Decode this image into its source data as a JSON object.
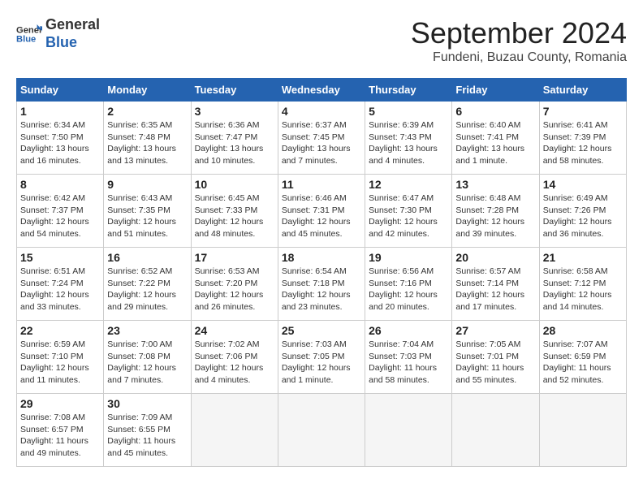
{
  "header": {
    "logo_line1": "General",
    "logo_line2": "Blue",
    "month_title": "September 2024",
    "location": "Fundeni, Buzau County, Romania"
  },
  "calendar": {
    "headers": [
      "Sunday",
      "Monday",
      "Tuesday",
      "Wednesday",
      "Thursday",
      "Friday",
      "Saturday"
    ],
    "weeks": [
      [
        {
          "day": "1",
          "info": "Sunrise: 6:34 AM\nSunset: 7:50 PM\nDaylight: 13 hours\nand 16 minutes."
        },
        {
          "day": "2",
          "info": "Sunrise: 6:35 AM\nSunset: 7:48 PM\nDaylight: 13 hours\nand 13 minutes."
        },
        {
          "day": "3",
          "info": "Sunrise: 6:36 AM\nSunset: 7:47 PM\nDaylight: 13 hours\nand 10 minutes."
        },
        {
          "day": "4",
          "info": "Sunrise: 6:37 AM\nSunset: 7:45 PM\nDaylight: 13 hours\nand 7 minutes."
        },
        {
          "day": "5",
          "info": "Sunrise: 6:39 AM\nSunset: 7:43 PM\nDaylight: 13 hours\nand 4 minutes."
        },
        {
          "day": "6",
          "info": "Sunrise: 6:40 AM\nSunset: 7:41 PM\nDaylight: 13 hours\nand 1 minute."
        },
        {
          "day": "7",
          "info": "Sunrise: 6:41 AM\nSunset: 7:39 PM\nDaylight: 12 hours\nand 58 minutes."
        }
      ],
      [
        {
          "day": "8",
          "info": "Sunrise: 6:42 AM\nSunset: 7:37 PM\nDaylight: 12 hours\nand 54 minutes."
        },
        {
          "day": "9",
          "info": "Sunrise: 6:43 AM\nSunset: 7:35 PM\nDaylight: 12 hours\nand 51 minutes."
        },
        {
          "day": "10",
          "info": "Sunrise: 6:45 AM\nSunset: 7:33 PM\nDaylight: 12 hours\nand 48 minutes."
        },
        {
          "day": "11",
          "info": "Sunrise: 6:46 AM\nSunset: 7:31 PM\nDaylight: 12 hours\nand 45 minutes."
        },
        {
          "day": "12",
          "info": "Sunrise: 6:47 AM\nSunset: 7:30 PM\nDaylight: 12 hours\nand 42 minutes."
        },
        {
          "day": "13",
          "info": "Sunrise: 6:48 AM\nSunset: 7:28 PM\nDaylight: 12 hours\nand 39 minutes."
        },
        {
          "day": "14",
          "info": "Sunrise: 6:49 AM\nSunset: 7:26 PM\nDaylight: 12 hours\nand 36 minutes."
        }
      ],
      [
        {
          "day": "15",
          "info": "Sunrise: 6:51 AM\nSunset: 7:24 PM\nDaylight: 12 hours\nand 33 minutes."
        },
        {
          "day": "16",
          "info": "Sunrise: 6:52 AM\nSunset: 7:22 PM\nDaylight: 12 hours\nand 29 minutes."
        },
        {
          "day": "17",
          "info": "Sunrise: 6:53 AM\nSunset: 7:20 PM\nDaylight: 12 hours\nand 26 minutes."
        },
        {
          "day": "18",
          "info": "Sunrise: 6:54 AM\nSunset: 7:18 PM\nDaylight: 12 hours\nand 23 minutes."
        },
        {
          "day": "19",
          "info": "Sunrise: 6:56 AM\nSunset: 7:16 PM\nDaylight: 12 hours\nand 20 minutes."
        },
        {
          "day": "20",
          "info": "Sunrise: 6:57 AM\nSunset: 7:14 PM\nDaylight: 12 hours\nand 17 minutes."
        },
        {
          "day": "21",
          "info": "Sunrise: 6:58 AM\nSunset: 7:12 PM\nDaylight: 12 hours\nand 14 minutes."
        }
      ],
      [
        {
          "day": "22",
          "info": "Sunrise: 6:59 AM\nSunset: 7:10 PM\nDaylight: 12 hours\nand 11 minutes."
        },
        {
          "day": "23",
          "info": "Sunrise: 7:00 AM\nSunset: 7:08 PM\nDaylight: 12 hours\nand 7 minutes."
        },
        {
          "day": "24",
          "info": "Sunrise: 7:02 AM\nSunset: 7:06 PM\nDaylight: 12 hours\nand 4 minutes."
        },
        {
          "day": "25",
          "info": "Sunrise: 7:03 AM\nSunset: 7:05 PM\nDaylight: 12 hours\nand 1 minute."
        },
        {
          "day": "26",
          "info": "Sunrise: 7:04 AM\nSunset: 7:03 PM\nDaylight: 11 hours\nand 58 minutes."
        },
        {
          "day": "27",
          "info": "Sunrise: 7:05 AM\nSunset: 7:01 PM\nDaylight: 11 hours\nand 55 minutes."
        },
        {
          "day": "28",
          "info": "Sunrise: 7:07 AM\nSunset: 6:59 PM\nDaylight: 11 hours\nand 52 minutes."
        }
      ],
      [
        {
          "day": "29",
          "info": "Sunrise: 7:08 AM\nSunset: 6:57 PM\nDaylight: 11 hours\nand 49 minutes."
        },
        {
          "day": "30",
          "info": "Sunrise: 7:09 AM\nSunset: 6:55 PM\nDaylight: 11 hours\nand 45 minutes."
        },
        {
          "day": "",
          "info": ""
        },
        {
          "day": "",
          "info": ""
        },
        {
          "day": "",
          "info": ""
        },
        {
          "day": "",
          "info": ""
        },
        {
          "day": "",
          "info": ""
        }
      ]
    ]
  }
}
